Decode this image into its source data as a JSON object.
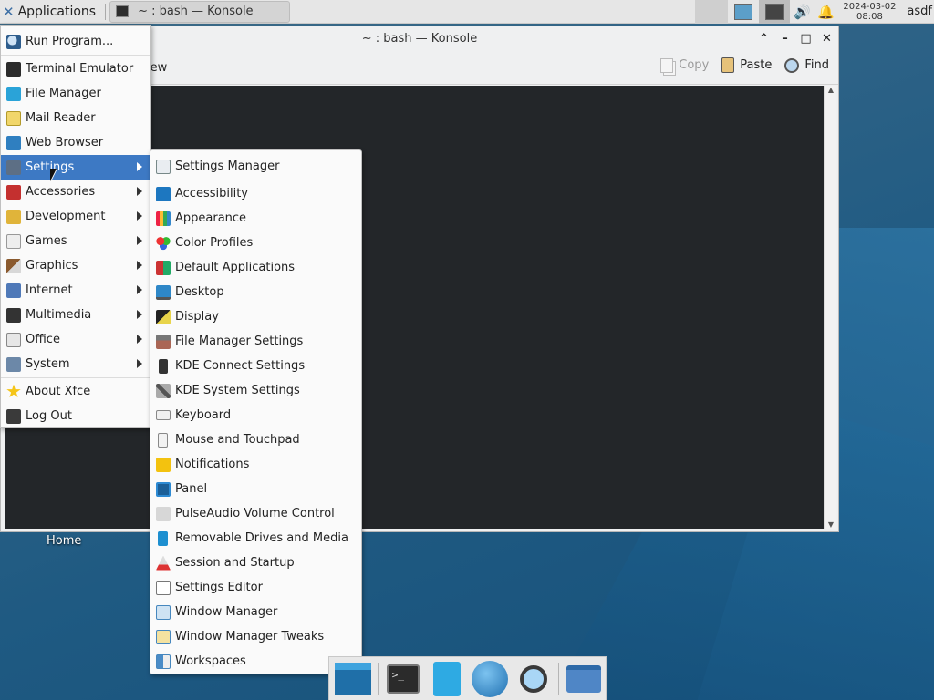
{
  "top_panel": {
    "applications_label": "Applications",
    "task_title": "~ : bash — Konsole",
    "clock_date": "2024-03-02",
    "clock_time": "08:08",
    "user": "asdf"
  },
  "window": {
    "title": "~ : bash — Konsole",
    "view_label": "iew",
    "copy_label": "Copy",
    "paste_label": "Paste",
    "find_label": "Find"
  },
  "desktop": {
    "home_label": "Home"
  },
  "app_menu": {
    "items": [
      {
        "label": "Run Program...",
        "icon": "search-icon"
      },
      {
        "label": "Terminal Emulator",
        "icon": "terminal-icon"
      },
      {
        "label": "File Manager",
        "icon": "file-manager-icon"
      },
      {
        "label": "Mail Reader",
        "icon": "mail-icon"
      },
      {
        "label": "Web Browser",
        "icon": "web-browser-icon"
      },
      {
        "label": "Settings",
        "icon": "settings-icon",
        "submenu": true,
        "active": true
      },
      {
        "label": "Accessories",
        "icon": "accessories-icon",
        "submenu": true
      },
      {
        "label": "Development",
        "icon": "development-icon",
        "submenu": true
      },
      {
        "label": "Games",
        "icon": "games-icon",
        "submenu": true
      },
      {
        "label": "Graphics",
        "icon": "graphics-icon",
        "submenu": true
      },
      {
        "label": "Internet",
        "icon": "internet-icon",
        "submenu": true
      },
      {
        "label": "Multimedia",
        "icon": "multimedia-icon",
        "submenu": true
      },
      {
        "label": "Office",
        "icon": "office-icon",
        "submenu": true
      },
      {
        "label": "System",
        "icon": "system-icon",
        "submenu": true
      },
      {
        "label": "About Xfce",
        "icon": "star-icon"
      },
      {
        "label": "Log Out",
        "icon": "logout-icon"
      }
    ]
  },
  "settings_menu": {
    "items": [
      {
        "label": "Settings Manager",
        "icon": "settings-manager-icon"
      },
      {
        "label": "Accessibility",
        "icon": "accessibility-icon"
      },
      {
        "label": "Appearance",
        "icon": "appearance-icon"
      },
      {
        "label": "Color Profiles",
        "icon": "color-profiles-icon"
      },
      {
        "label": "Default Applications",
        "icon": "default-applications-icon"
      },
      {
        "label": "Desktop",
        "icon": "desktop-icon"
      },
      {
        "label": "Display",
        "icon": "display-icon"
      },
      {
        "label": "File Manager Settings",
        "icon": "file-manager-settings-icon"
      },
      {
        "label": "KDE Connect Settings",
        "icon": "kde-connect-icon"
      },
      {
        "label": "KDE System Settings",
        "icon": "kde-system-settings-icon"
      },
      {
        "label": "Keyboard",
        "icon": "keyboard-icon"
      },
      {
        "label": "Mouse and Touchpad",
        "icon": "mouse-icon"
      },
      {
        "label": "Notifications",
        "icon": "bell-icon"
      },
      {
        "label": "Panel",
        "icon": "panel-icon"
      },
      {
        "label": "PulseAudio Volume Control",
        "icon": "pulseaudio-icon"
      },
      {
        "label": "Removable Drives and Media",
        "icon": "removable-drive-icon"
      },
      {
        "label": "Session and Startup",
        "icon": "rocket-icon"
      },
      {
        "label": "Settings Editor",
        "icon": "settings-editor-icon"
      },
      {
        "label": "Window Manager",
        "icon": "window-manager-icon"
      },
      {
        "label": "Window Manager Tweaks",
        "icon": "window-manager-tweaks-icon"
      },
      {
        "label": "Workspaces",
        "icon": "workspaces-icon"
      }
    ]
  },
  "dock": {
    "items": [
      {
        "icon": "show-desktop-icon"
      },
      {
        "icon": "terminal-icon"
      },
      {
        "icon": "file-manager-icon"
      },
      {
        "icon": "web-browser-icon"
      },
      {
        "icon": "app-finder-icon"
      },
      {
        "icon": "folder-icon"
      }
    ]
  }
}
